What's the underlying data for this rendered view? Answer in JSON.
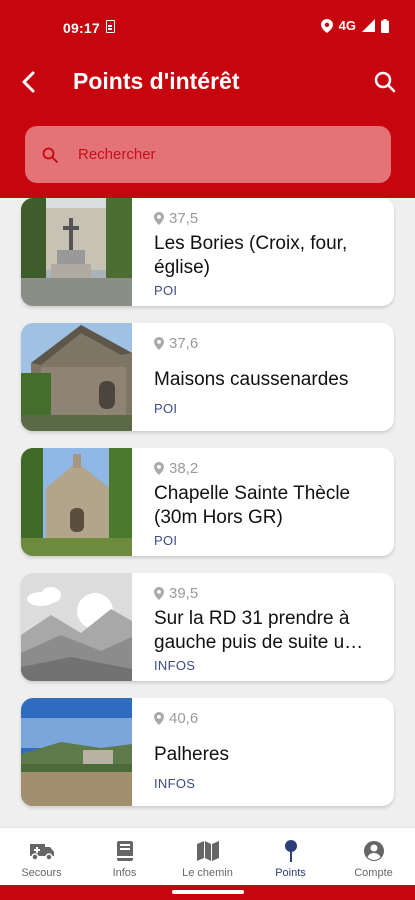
{
  "status": {
    "time": "09:17",
    "network": "4G"
  },
  "header": {
    "title": "Points d'intérêt"
  },
  "search": {
    "placeholder": "Rechercher"
  },
  "items": [
    {
      "distance": "37,5",
      "title": "Les Bories (Croix, four, église)",
      "type": "POI"
    },
    {
      "distance": "37,6",
      "title": "Maisons caussenardes",
      "type": "POI"
    },
    {
      "distance": "38,2",
      "title": "Chapelle Sainte Thècle (30m Hors GR)",
      "type": "POI"
    },
    {
      "distance": "39,5",
      "title": "Sur la RD 31 prendre à gauche puis de suite u…",
      "type": "INFOS"
    },
    {
      "distance": "40,6",
      "title": "Palheres",
      "type": "INFOS"
    }
  ],
  "nav": {
    "items": [
      {
        "label": "Secours",
        "icon": "ambulance-icon"
      },
      {
        "label": "Infos",
        "icon": "book-icon"
      },
      {
        "label": "Le chemin",
        "icon": "map-icon"
      },
      {
        "label": "Points",
        "icon": "pin-icon"
      },
      {
        "label": "Compte",
        "icon": "account-icon"
      }
    ],
    "active_index": 3
  },
  "colors": {
    "brand": "#c6050f",
    "active": "#2c3e78",
    "type_text": "#3c4c86"
  }
}
